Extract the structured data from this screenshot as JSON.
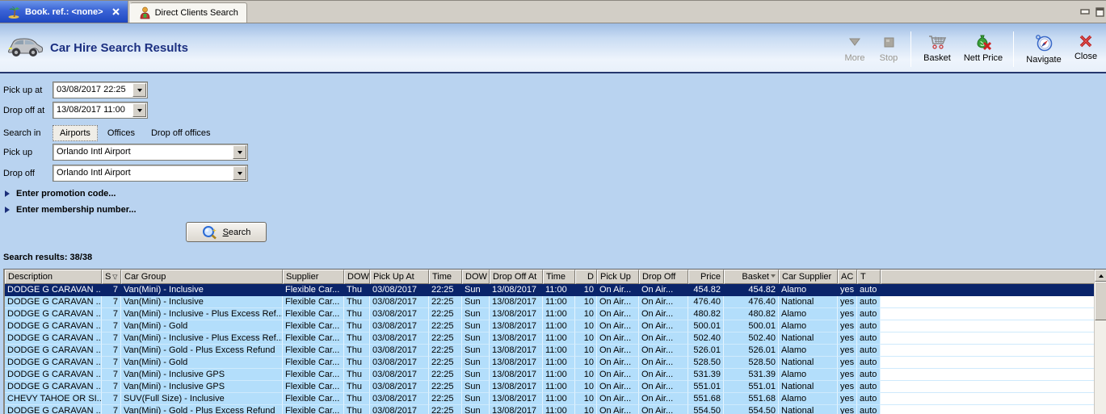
{
  "window": {
    "tabs": [
      {
        "label": "Book. ref.: <none>",
        "icon": "palm-tree-icon",
        "active": true,
        "closable": true
      },
      {
        "label": "Direct Clients Search",
        "icon": "person-icon",
        "active": false
      }
    ]
  },
  "header": {
    "title": "Car Hire Search Results",
    "icon": "car-icon"
  },
  "toolbar": {
    "more": {
      "label": "More",
      "disabled": true,
      "icon": "more-icon"
    },
    "stop": {
      "label": "Stop",
      "disabled": true,
      "icon": "stop-icon"
    },
    "basket": {
      "label": "Basket",
      "disabled": false,
      "icon": "basket-icon"
    },
    "nett_price": {
      "label": "Nett Price",
      "disabled": false,
      "icon": "nett-price-icon"
    },
    "navigate": {
      "label": "Navigate",
      "disabled": false,
      "icon": "navigate-icon"
    },
    "close": {
      "label": "Close",
      "disabled": false,
      "icon": "close-icon"
    }
  },
  "form": {
    "pick_up_at": {
      "label": "Pick up at",
      "value": "03/08/2017 22:25"
    },
    "drop_off_at": {
      "label": "Drop off at",
      "value": "13/08/2017 11:00"
    },
    "search_in": {
      "label": "Search in",
      "options": [
        "Airports",
        "Offices",
        "Drop off offices"
      ],
      "selected": "Airports"
    },
    "pick_up": {
      "label": "Pick up",
      "value": "Orlando Intl Airport"
    },
    "drop_off": {
      "label": "Drop off",
      "value": "Orlando Intl Airport"
    },
    "promotion_toggle": "Enter promotion code...",
    "membership_toggle": "Enter membership number...",
    "search_button": "Search"
  },
  "results": {
    "summary": "Search results: 38/38",
    "selected_row": 0,
    "sorted_column": "Basket",
    "filtered_column": "S",
    "columns": [
      "Description",
      "S",
      "Car Group",
      "Supplier",
      "DOW",
      "Pick Up At",
      "Time",
      "DOW",
      "Drop Off At",
      "Time",
      "D",
      "Pick Up",
      "Drop Off",
      "Price",
      "Basket",
      "Car Supplier",
      "AC",
      "T"
    ],
    "rows": [
      [
        "DODGE G CARAVAN ...",
        "7",
        "Van(Mini) - Inclusive",
        "Flexible Car...",
        "Thu",
        "03/08/2017",
        "22:25",
        "Sun",
        "13/08/2017",
        "11:00",
        "10",
        "On Air...",
        "On Air...",
        "454.82",
        "454.82",
        "Alamo",
        "yes",
        "auto"
      ],
      [
        "DODGE G CARAVAN ...",
        "7",
        "Van(Mini) - Inclusive",
        "Flexible Car...",
        "Thu",
        "03/08/2017",
        "22:25",
        "Sun",
        "13/08/2017",
        "11:00",
        "10",
        "On Air...",
        "On Air...",
        "476.40",
        "476.40",
        "National",
        "yes",
        "auto"
      ],
      [
        "DODGE G CARAVAN ...",
        "7",
        "Van(Mini) - Inclusive - Plus Excess Ref...",
        "Flexible Car...",
        "Thu",
        "03/08/2017",
        "22:25",
        "Sun",
        "13/08/2017",
        "11:00",
        "10",
        "On Air...",
        "On Air...",
        "480.82",
        "480.82",
        "Alamo",
        "yes",
        "auto"
      ],
      [
        "DODGE G CARAVAN ...",
        "7",
        "Van(Mini) - Gold",
        "Flexible Car...",
        "Thu",
        "03/08/2017",
        "22:25",
        "Sun",
        "13/08/2017",
        "11:00",
        "10",
        "On Air...",
        "On Air...",
        "500.01",
        "500.01",
        "Alamo",
        "yes",
        "auto"
      ],
      [
        "DODGE G CARAVAN ...",
        "7",
        "Van(Mini) - Inclusive - Plus Excess Ref...",
        "Flexible Car...",
        "Thu",
        "03/08/2017",
        "22:25",
        "Sun",
        "13/08/2017",
        "11:00",
        "10",
        "On Air...",
        "On Air...",
        "502.40",
        "502.40",
        "National",
        "yes",
        "auto"
      ],
      [
        "DODGE G CARAVAN ...",
        "7",
        "Van(Mini) - Gold - Plus Excess Refund",
        "Flexible Car...",
        "Thu",
        "03/08/2017",
        "22:25",
        "Sun",
        "13/08/2017",
        "11:00",
        "10",
        "On Air...",
        "On Air...",
        "526.01",
        "526.01",
        "Alamo",
        "yes",
        "auto"
      ],
      [
        "DODGE G CARAVAN ...",
        "7",
        "Van(Mini) - Gold",
        "Flexible Car...",
        "Thu",
        "03/08/2017",
        "22:25",
        "Sun",
        "13/08/2017",
        "11:00",
        "10",
        "On Air...",
        "On Air...",
        "528.50",
        "528.50",
        "National",
        "yes",
        "auto"
      ],
      [
        "DODGE G CARAVAN ...",
        "7",
        "Van(Mini) - Inclusive GPS",
        "Flexible Car...",
        "Thu",
        "03/08/2017",
        "22:25",
        "Sun",
        "13/08/2017",
        "11:00",
        "10",
        "On Air...",
        "On Air...",
        "531.39",
        "531.39",
        "Alamo",
        "yes",
        "auto"
      ],
      [
        "DODGE G CARAVAN ...",
        "7",
        "Van(Mini) - Inclusive GPS",
        "Flexible Car...",
        "Thu",
        "03/08/2017",
        "22:25",
        "Sun",
        "13/08/2017",
        "11:00",
        "10",
        "On Air...",
        "On Air...",
        "551.01",
        "551.01",
        "National",
        "yes",
        "auto"
      ],
      [
        "CHEVY TAHOE OR SI...",
        "7",
        "SUV(Full Size) - Inclusive",
        "Flexible Car...",
        "Thu",
        "03/08/2017",
        "22:25",
        "Sun",
        "13/08/2017",
        "11:00",
        "10",
        "On Air...",
        "On Air...",
        "551.68",
        "551.68",
        "Alamo",
        "yes",
        "auto"
      ],
      [
        "DODGE G CARAVAN ...",
        "7",
        "Van(Mini) - Gold - Plus Excess Refund",
        "Flexible Car...",
        "Thu",
        "03/08/2017",
        "22:25",
        "Sun",
        "13/08/2017",
        "11:00",
        "10",
        "On Air...",
        "On Air...",
        "554.50",
        "554.50",
        "National",
        "yes",
        "auto"
      ]
    ]
  },
  "colors": {
    "selection_bg": "#0a246a",
    "row_bg": "#b3defb",
    "active_tab": "#2a52c8",
    "title_text": "#1b2f80",
    "close_red": "#cc2222"
  }
}
